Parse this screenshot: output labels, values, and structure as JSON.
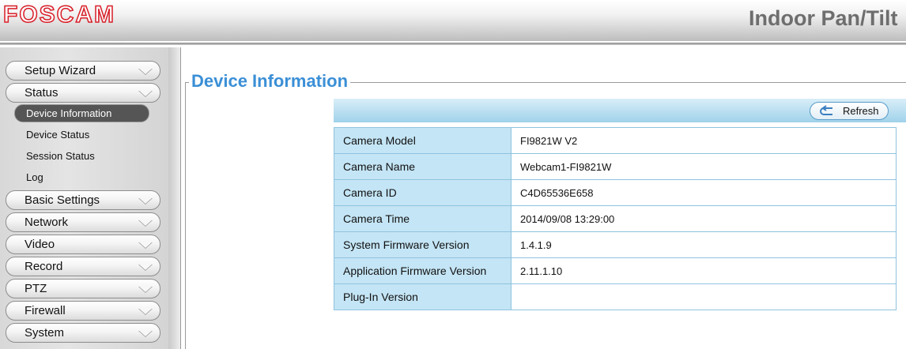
{
  "header": {
    "logo": "FOSCAM",
    "product_title": "Indoor Pan/Tilt"
  },
  "sidebar": {
    "items": [
      {
        "label": "Setup Wizard"
      },
      {
        "label": "Status"
      },
      {
        "label": "Basic Settings"
      },
      {
        "label": "Network"
      },
      {
        "label": "Video"
      },
      {
        "label": "Record"
      },
      {
        "label": "PTZ"
      },
      {
        "label": "Firewall"
      },
      {
        "label": "System"
      }
    ],
    "status_sub": [
      {
        "label": "Device Information",
        "active": true
      },
      {
        "label": "Device Status"
      },
      {
        "label": "Session Status"
      },
      {
        "label": "Log"
      }
    ]
  },
  "main": {
    "section_title": "Device Information",
    "refresh_label": "Refresh",
    "rows": [
      {
        "label": "Camera Model",
        "value": "FI9821W V2"
      },
      {
        "label": "Camera Name",
        "value": "Webcam1-FI9821W"
      },
      {
        "label": "Camera ID",
        "value": "C4D65536E658"
      },
      {
        "label": "Camera Time",
        "value": "2014/09/08 13:29:00"
      },
      {
        "label": "System Firmware Version",
        "value": "1.4.1.9"
      },
      {
        "label": "Application Firmware Version",
        "value": "2.11.1.10"
      },
      {
        "label": "Plug-In Version",
        "value": ""
      }
    ]
  },
  "colors": {
    "brand_red": "#d8202a",
    "title_blue": "#3b8fd6",
    "table_key_bg": "#c4e5f5"
  }
}
